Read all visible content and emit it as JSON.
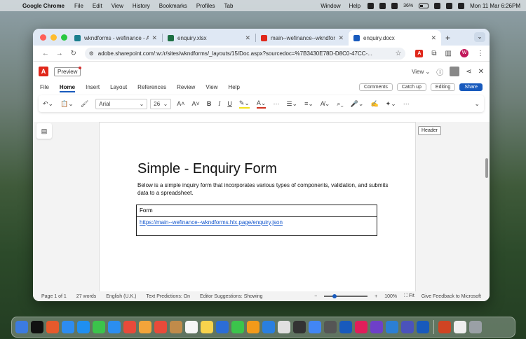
{
  "menubar": {
    "app": "Google Chrome",
    "items": [
      "File",
      "Edit",
      "View",
      "History",
      "Bookmarks",
      "Profiles",
      "Tab"
    ],
    "right_items": [
      "Window",
      "Help"
    ],
    "battery": "36%",
    "datetime": "Mon 11 Mar  6:26PM"
  },
  "browser": {
    "tabs": [
      {
        "title": "wkndforms - wefinance - All",
        "color": "#1a7f8e"
      },
      {
        "title": "enquiry.xlsx",
        "color": "#1d6f42"
      },
      {
        "title": "main--wefinance--wkndform",
        "color": "#e0271a"
      },
      {
        "title": "enquiry.docx",
        "color": "#185abd"
      }
    ],
    "url": "adobe.sharepoint.com/:w:/r/sites/wkndforms/_layouts/15/Doc.aspx?sourcedoc=%7B3430E78D-D8C0-47CC-...",
    "profile_initial": "W"
  },
  "office": {
    "preview_label": "Preview",
    "view_label": "View",
    "ribbon_tabs": [
      "File",
      "Home",
      "Insert",
      "Layout",
      "References",
      "Review",
      "View",
      "Help"
    ],
    "comments": "Comments",
    "catchup": "Catch up",
    "editing": "Editing",
    "share": "Share",
    "font_name": "Arial",
    "font_size": "26"
  },
  "document": {
    "header_tag": "Header",
    "title": "Simple - Enquiry Form",
    "description": "Below is a simple inquiry form that incorporates various types of components, validation, and submits data to a spreadsheet.",
    "table": {
      "row1": "Form",
      "row2": "https://main--wefinance--wkndforms.hlx.page/enquiry.json"
    }
  },
  "status": {
    "page": "Page 1 of 1",
    "words": "27 words",
    "language": "English (U.K.)",
    "predictions": "Text Predictions: On",
    "editor": "Editor Suggestions: Showing",
    "zoom": "100%",
    "fit": "Fit",
    "feedback": "Give Feedback to Microsoft"
  },
  "dock_colors": [
    "#3c7be0",
    "#111111",
    "#e65a2c",
    "#2d8cf0",
    "#1f8ff0",
    "#3bc44b",
    "#2b8ef0",
    "#e84a3a",
    "#f3a43a",
    "#e84a3a",
    "#c08b4a",
    "#f5f5f5",
    "#f8d34c",
    "#2b6dd6",
    "#3bc44b",
    "#f39a1a",
    "#2a7fe0",
    "#e0e0e0",
    "#333333",
    "#4286f4",
    "#555555",
    "#185abd",
    "#e01e5a",
    "#6e40c9",
    "#2b7fd4",
    "#4b53bc",
    "#185abd",
    "#d04423",
    "#eeeeee",
    "#9aa0a6"
  ]
}
